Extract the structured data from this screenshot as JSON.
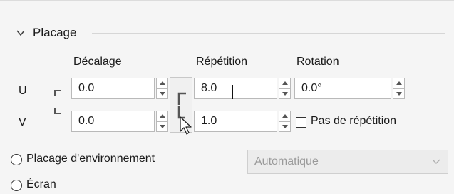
{
  "section": {
    "title": "Placage"
  },
  "columns": {
    "offset": "Décalage",
    "repeat": "Répétition",
    "rotation": "Rotation"
  },
  "rows": {
    "u": "U",
    "v": "V"
  },
  "fields": {
    "u_offset": "0.0",
    "v_offset": "0.0",
    "u_repeat": "8.0",
    "v_repeat": "1.0",
    "u_rotation": "0.0°"
  },
  "no_repeat": {
    "label": "Pas de répétition",
    "checked": false
  },
  "radios": {
    "environment": "Placage d'environnement",
    "screen": "Écran"
  },
  "dropdown": {
    "selected": "Automatique",
    "enabled": false
  },
  "icons": [
    "chevron-down-icon",
    "chain-link-icon",
    "spin-up-icon",
    "spin-down-icon",
    "mouse-cursor-icon"
  ]
}
